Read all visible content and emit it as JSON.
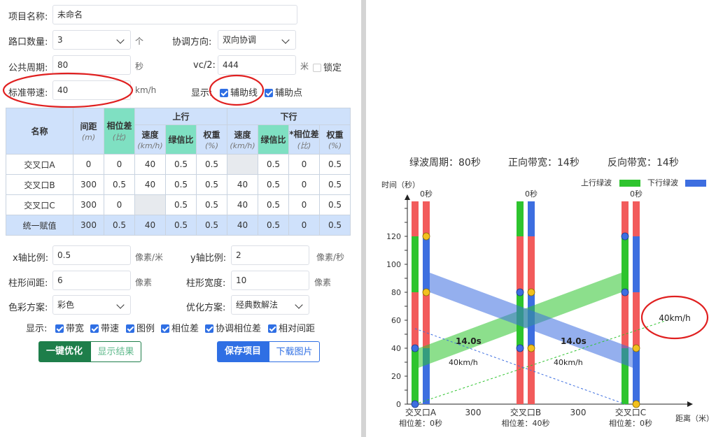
{
  "form": {
    "project_name_label": "项目名称:",
    "project_name_value": "未命名",
    "intersections_label": "路口数量:",
    "intersections_value": "3",
    "intersections_unit": "个",
    "direction_label": "协调方向:",
    "direction_value": "双向协调",
    "cycle_label": "公共周期:",
    "cycle_value": "80",
    "cycle_unit": "秒",
    "vc_label": "vc/2:",
    "vc_value": "444",
    "vc_unit": "米",
    "lock_label": "锁定",
    "speed_label": "标准带速:",
    "speed_value": "40",
    "speed_unit": "km/h",
    "show_label": "显示:",
    "aux_line_label": "辅助线",
    "aux_point_label": "辅助点"
  },
  "table": {
    "header_name": "名称",
    "header_distance": "间距",
    "header_distance_unit": "(m)",
    "header_phase": "相位差",
    "header_phase_unit": "(比)",
    "header_up": "上行",
    "header_down": "下行",
    "header_speed": "速度",
    "header_speed_unit": "(km/h)",
    "header_green": "绿信比",
    "header_weight": "权重",
    "header_weight_unit": "(%)",
    "header_down_phase": "*相位差",
    "rows": [
      {
        "name": "交叉口A",
        "dist": "0",
        "phase": "0",
        "up_speed": "40",
        "up_green": "0.5",
        "up_weight": "0.5",
        "dn_speed": "",
        "dn_green": "0.5",
        "dn_phase": "0",
        "dn_weight": "0.5"
      },
      {
        "name": "交叉口B",
        "dist": "300",
        "phase": "0.5",
        "up_speed": "40",
        "up_green": "0.5",
        "up_weight": "0.5",
        "dn_speed": "40",
        "dn_green": "0.5",
        "dn_phase": "0",
        "dn_weight": "0.5"
      },
      {
        "name": "交叉口C",
        "dist": "300",
        "phase": "0",
        "up_speed": "",
        "up_green": "0.5",
        "up_weight": "0.5",
        "dn_speed": "40",
        "dn_green": "0.5",
        "dn_phase": "0",
        "dn_weight": "0.5"
      },
      {
        "name": "统一赋值",
        "dist": "300",
        "phase": "0.5",
        "up_speed": "40",
        "up_green": "0.5",
        "up_weight": "0.5",
        "dn_speed": "40",
        "dn_green": "0.5",
        "dn_phase": "0",
        "dn_weight": "0.5"
      }
    ]
  },
  "settings": {
    "xscale_label": "x轴比例:",
    "xscale_value": "0.5",
    "xscale_unit": "像素/米",
    "yscale_label": "y轴比例:",
    "yscale_value": "2",
    "yscale_unit": "像素/秒",
    "bar_gap_label": "柱形间距:",
    "bar_gap_value": "6",
    "bar_gap_unit": "像素",
    "bar_width_label": "柱形宽度:",
    "bar_width_value": "10",
    "bar_width_unit": "像素",
    "color_label": "色彩方案:",
    "color_value": "彩色",
    "optimize_label": "优化方案:",
    "optimize_value": "经典数解法",
    "display_label": "显示:",
    "display_options": [
      "带宽",
      "带速",
      "图例",
      "相位差",
      "协调相位差",
      "相对间距"
    ]
  },
  "buttons": {
    "optimize": "一键优化",
    "show_result": "显示结果",
    "save": "保存项目",
    "download": "下载图片"
  },
  "colors": {
    "accent": "#2f6fe4",
    "dark_green": "#1e7e4a",
    "red_phase": "#f25b5b",
    "green_phase": "#2ec42e",
    "blue_phase": "#3d6ee0",
    "annotation_red": "#e02020"
  },
  "chart_data": {
    "type": "time-space-diagram",
    "summary": {
      "cycle": "绿波周期：80秒",
      "forward": "正向带宽：14秒",
      "reverse": "反向带宽：14秒"
    },
    "ylabel": "时间（秒）",
    "xlabel": "距离（米）",
    "legend": {
      "up": "上行绿波",
      "down": "下行绿波"
    },
    "ylim": [
      0,
      145
    ],
    "yticks": [
      0,
      20,
      40,
      60,
      80,
      100,
      120
    ],
    "intersections": [
      {
        "name": "交叉口A",
        "position": 0,
        "phase_label": "相位差：0秒",
        "top_label": "0秒"
      },
      {
        "name": "交叉口B",
        "position": 300,
        "phase_label": "相位差：40秒",
        "top_label": "0秒"
      },
      {
        "name": "交叉口C",
        "position": 600,
        "phase_label": "相位差：0秒",
        "top_label": "0秒"
      }
    ],
    "spacing_labels": [
      "300",
      "300"
    ],
    "up_band": {
      "start_time": [
        26,
        40
      ],
      "end_time": [
        80,
        94
      ],
      "bandwidth_label": "14.0s",
      "speed_label": "40km/h"
    },
    "down_band": {
      "start_time": [
        80,
        94
      ],
      "end_time": [
        26,
        40
      ],
      "bandwidth_label": "14.0s",
      "speed_label": "40km/h"
    },
    "aux_speed_label": "40km/h",
    "aux_speed_line": {
      "up": [
        [
          0,
          0
        ],
        [
          600,
          54
        ]
      ],
      "down": [
        [
          0,
          54
        ],
        [
          600,
          0
        ]
      ]
    },
    "up_bars": [
      {
        "x": 0,
        "segments": [
          [
            0,
            40,
            "green"
          ],
          [
            40,
            80,
            "red"
          ],
          [
            80,
            120,
            "green"
          ],
          [
            120,
            145,
            "red"
          ]
        ]
      },
      {
        "x": 300,
        "segments": [
          [
            0,
            40,
            "red"
          ],
          [
            40,
            80,
            "green"
          ],
          [
            80,
            120,
            "red"
          ],
          [
            120,
            145,
            "green"
          ]
        ]
      },
      {
        "x": 600,
        "segments": [
          [
            0,
            40,
            "green"
          ],
          [
            40,
            80,
            "red"
          ],
          [
            80,
            120,
            "green"
          ],
          [
            120,
            145,
            "red"
          ]
        ]
      }
    ],
    "down_bars": [
      {
        "x": 0,
        "segments": [
          [
            0,
            40,
            "blue"
          ],
          [
            40,
            80,
            "red"
          ],
          [
            80,
            120,
            "blue"
          ],
          [
            120,
            145,
            "red"
          ]
        ]
      },
      {
        "x": 300,
        "segments": [
          [
            0,
            40,
            "red"
          ],
          [
            40,
            80,
            "blue"
          ],
          [
            80,
            120,
            "red"
          ],
          [
            120,
            145,
            "blue"
          ]
        ]
      },
      {
        "x": 600,
        "segments": [
          [
            0,
            40,
            "blue"
          ],
          [
            40,
            80,
            "red"
          ],
          [
            80,
            120,
            "blue"
          ],
          [
            120,
            145,
            "red"
          ]
        ]
      }
    ],
    "blue_points": [
      [
        0,
        0,
        "up"
      ],
      [
        0,
        40,
        "up"
      ],
      [
        300,
        80,
        "up"
      ],
      [
        300,
        40,
        "up"
      ],
      [
        600,
        120,
        "up"
      ],
      [
        600,
        80,
        "up"
      ]
    ],
    "yellow_points": [
      [
        0,
        120,
        "down"
      ],
      [
        0,
        80,
        "down"
      ],
      [
        300,
        80,
        "down"
      ],
      [
        300,
        40,
        "down"
      ],
      [
        600,
        40,
        "down"
      ],
      [
        600,
        0,
        "down"
      ]
    ]
  }
}
